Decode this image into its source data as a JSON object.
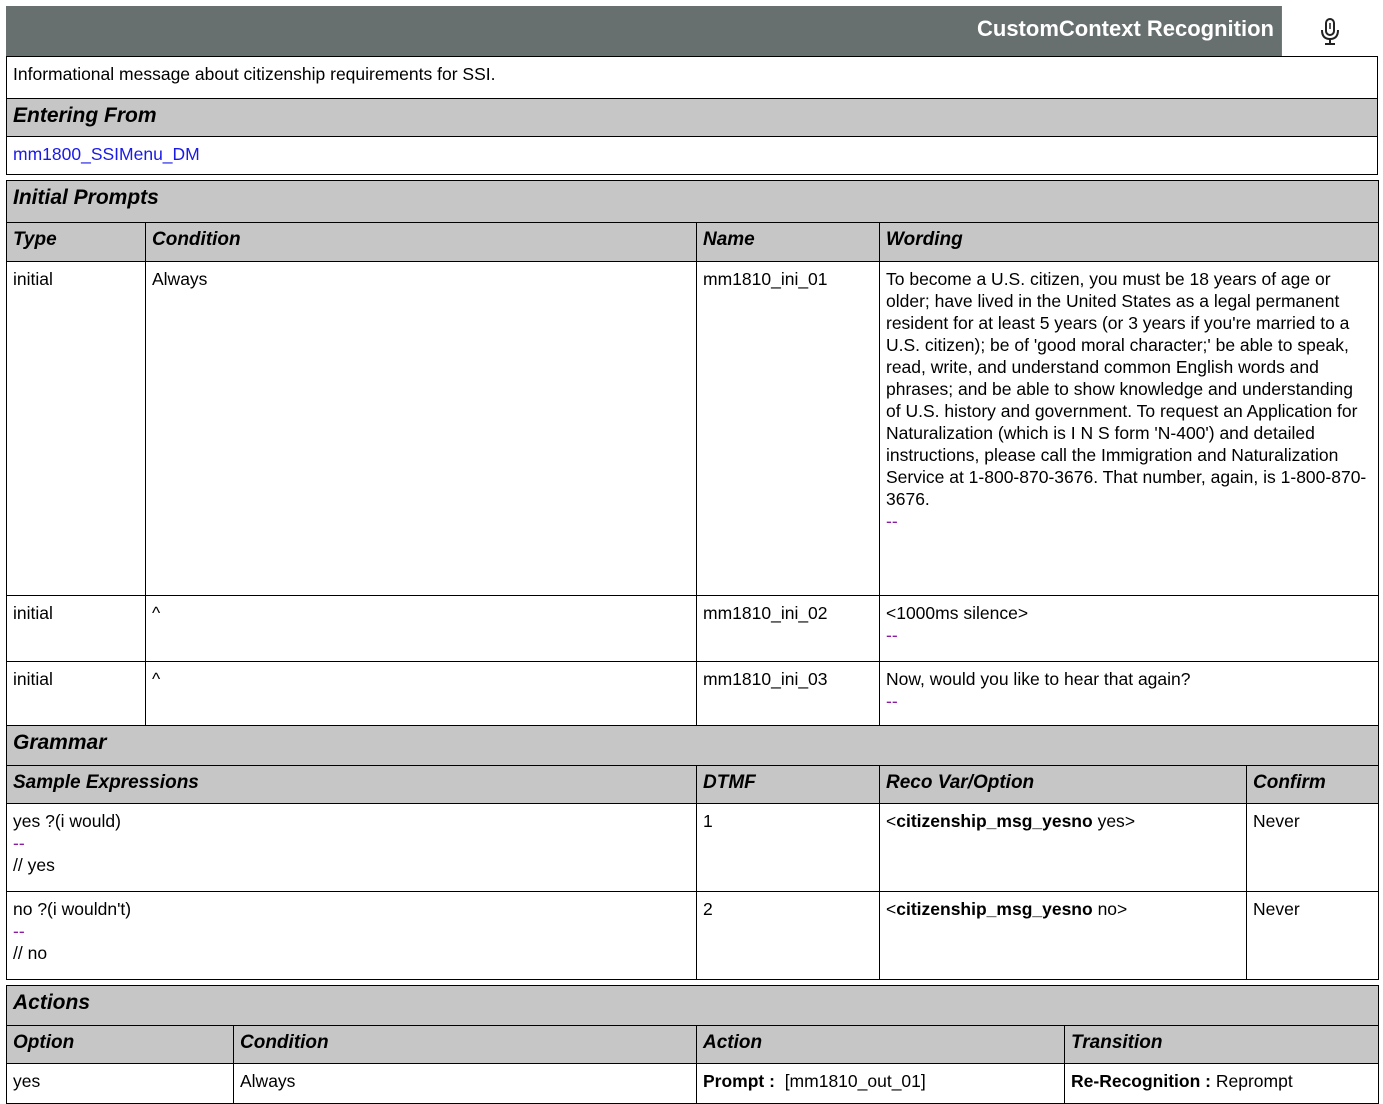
{
  "header": {
    "title": "CustomContext Recognition",
    "icon": "microphone-icon"
  },
  "description": "Informational message about citizenship requirements for SSI.",
  "entering_from": {
    "label": "Entering From",
    "link": "mm1800_SSIMenu_DM"
  },
  "initial_prompts": {
    "label": "Initial Prompts",
    "columns": [
      "Type",
      "Condition",
      "Name",
      "Wording"
    ],
    "rows": [
      {
        "type": "initial",
        "condition": "Always",
        "name": "mm1810_ini_01",
        "wording": "To become a U.S. citizen, you must be 18 years of age or older; have lived in the United States as a legal permanent resident for at least 5 years (or 3 years if you're married to a U.S. citizen); be of 'good moral character;' be able to speak, read, write, and understand common English words and phrases; and be able to show knowledge and understanding of U.S. history and government. To request an Application for Naturalization (which is I N S form 'N-400') and detailed instructions, please call the Immigration and Naturalization Service at 1-800-870-3676. That number, again, is 1-800-870-3676.",
        "marker": "--"
      },
      {
        "type": "initial",
        "condition": "^",
        "name": "mm1810_ini_02",
        "wording": "<1000ms silence>",
        "marker": "--"
      },
      {
        "type": "initial",
        "condition": "^",
        "name": "mm1810_ini_03",
        "wording": "Now, would you like to hear that again?",
        "marker": "--"
      }
    ]
  },
  "grammar": {
    "label": "Grammar",
    "columns": [
      "Sample Expressions",
      "DTMF",
      "Reco Var/Option",
      "Confirm"
    ],
    "rows": [
      {
        "expr": "yes ?(i would)",
        "marker": "--",
        "comment": "// yes",
        "dtmf": "1",
        "var": "citizenship_msg_yesno",
        "option": "yes",
        "confirm": "Never"
      },
      {
        "expr": "no ?(i wouldn't)",
        "marker": "--",
        "comment": "// no",
        "dtmf": "2",
        "var": "citizenship_msg_yesno",
        "option": "no",
        "confirm": "Never"
      }
    ]
  },
  "actions": {
    "label": "Actions",
    "columns": [
      "Option",
      "Condition",
      "Action",
      "Transition"
    ],
    "rows": [
      {
        "option": "yes",
        "condition": "Always",
        "action_label": "Prompt :",
        "action_value": "[mm1810_out_01]",
        "transition_label": "Re-Recognition :",
        "transition_value": "Reprompt"
      }
    ]
  }
}
